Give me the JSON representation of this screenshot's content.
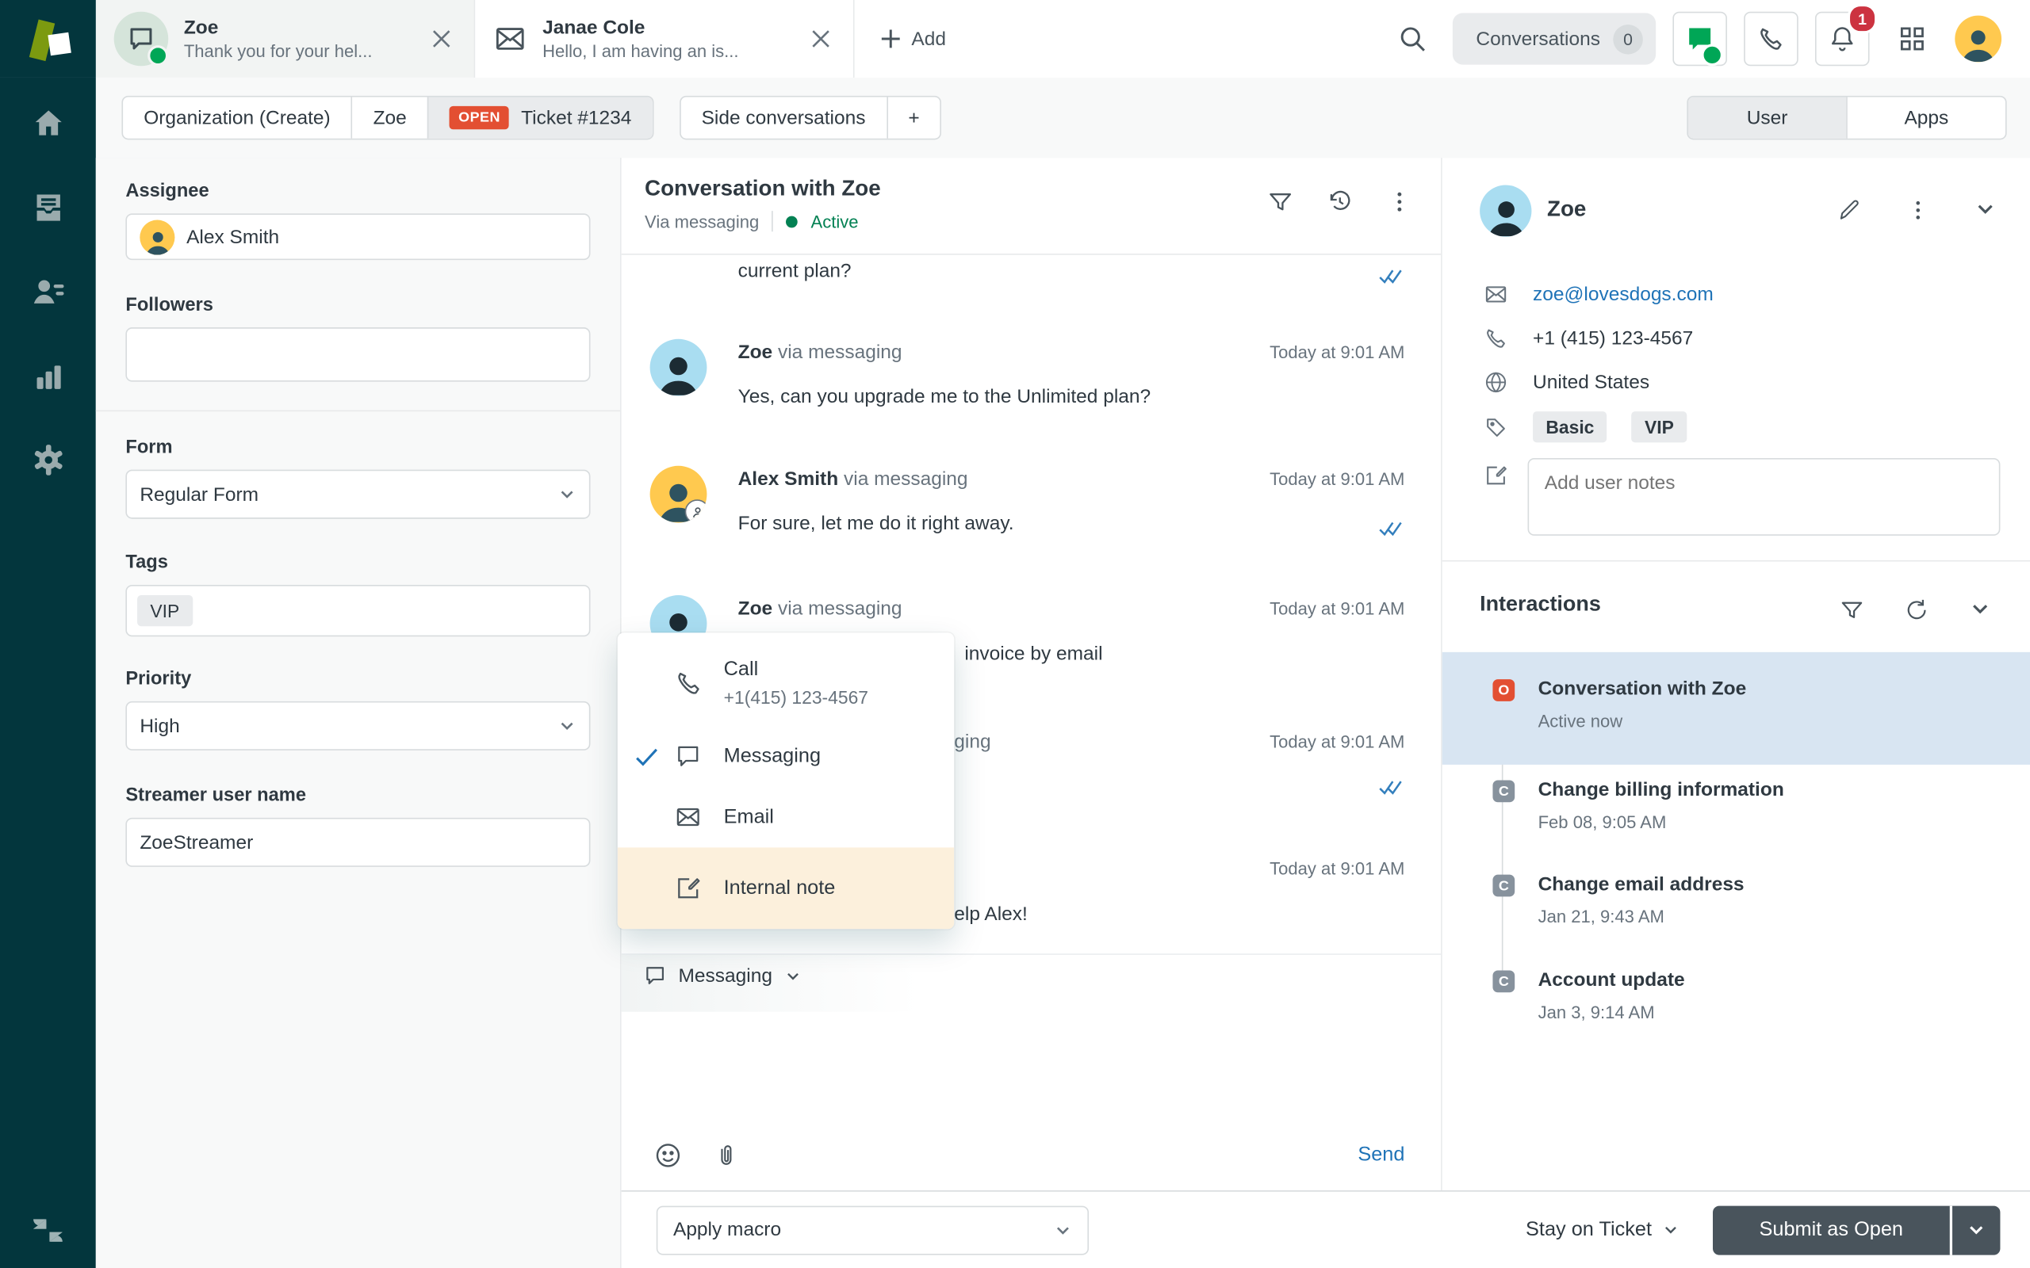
{
  "colors": {
    "brand_teal": "#03363d",
    "accent_green": "#00a656",
    "active_green": "#038153",
    "link_blue": "#1f73b7",
    "check_blue": "#337fbd",
    "status_red": "#e34f32",
    "alert_red": "#cc3340",
    "selected_row_blue": "#d8e5f2",
    "note_highlight": "#fcf0dc",
    "submit_dark": "#49545c"
  },
  "icons": [
    "message-bubble-icon",
    "email-envelope-icon",
    "plus-icon",
    "search-icon",
    "phone-icon",
    "bell-icon",
    "grid-icon",
    "home-icon",
    "views-icon",
    "customers-icon",
    "reporting-icon",
    "admin-gear-icon",
    "funnel-icon",
    "history-icon",
    "kebab-icon",
    "pencil-icon",
    "chevron-down-icon",
    "globe-icon",
    "tag-icon",
    "note-icon",
    "smiley-icon",
    "paperclip-icon",
    "check-icon",
    "double-check-icon",
    "refresh-icon",
    "zendesk-logo"
  ],
  "topbar": {
    "tabs": [
      {
        "title": "Zoe",
        "subtitle": "Thank you for your hel..."
      },
      {
        "title": "Janae Cole",
        "subtitle": "Hello, I am having an is..."
      }
    ],
    "add_label": "Add",
    "conversations": {
      "label": "Conversations",
      "count": "0"
    },
    "notifications_count": "1"
  },
  "breadcrumb": {
    "org": "Organization (Create)",
    "person": "Zoe",
    "status": "OPEN",
    "ticket": "Ticket #1234",
    "side_conversations": "Side conversations",
    "add": "+"
  },
  "panel_tabs": {
    "user": "User",
    "apps": "Apps"
  },
  "fields": {
    "assignee": {
      "label": "Assignee",
      "value": "Alex Smith"
    },
    "followers": {
      "label": "Followers",
      "value": ""
    },
    "form": {
      "label": "Form",
      "value": "Regular Form"
    },
    "tags": {
      "label": "Tags",
      "values": [
        "VIP"
      ]
    },
    "priority": {
      "label": "Priority",
      "value": "High"
    },
    "streamer": {
      "label": "Streamer user name",
      "value": "ZoeStreamer"
    }
  },
  "conversation": {
    "title": "Conversation with Zoe",
    "via": "Via messaging",
    "status": "Active",
    "messages": [
      {
        "fragment_text": "current plan?"
      },
      {
        "author": "Zoe",
        "via": "via messaging",
        "time": "Today at 9:01 AM",
        "text": "Yes, can you upgrade me to the Unlimited plan?"
      },
      {
        "author": "Alex Smith",
        "via": "via messaging",
        "time": "Today at 9:01 AM",
        "text": "For sure, let me do it right away."
      },
      {
        "author": "Zoe",
        "via": "via messaging",
        "time": "Today at 9:01 AM",
        "fragment_text": "invoice by email"
      },
      {
        "via_fragment": "ging",
        "time": "Today at 9:01 AM"
      },
      {
        "time": "Today at 9:01 AM",
        "fragment_text": "elp Alex!"
      }
    ]
  },
  "channel_menu": {
    "items": [
      {
        "label": "Call",
        "sublabel": "+1(415) 123-4567"
      },
      {
        "label": "Messaging",
        "selected": true
      },
      {
        "label": "Email"
      },
      {
        "label": "Internal note",
        "highlighted": true
      }
    ]
  },
  "composer": {
    "channel": "Messaging",
    "send_label": "Send"
  },
  "footer": {
    "apply_macro": "Apply macro",
    "stay_on_ticket": "Stay on Ticket",
    "submit": "Submit as Open"
  },
  "customer": {
    "name": "Zoe",
    "email": "zoe@lovesdogs.com",
    "phone": "+1 (415) 123-4567",
    "country": "United States",
    "tags": [
      "Basic",
      "VIP"
    ],
    "notes_placeholder": "Add user notes"
  },
  "interactions": {
    "title": "Interactions",
    "items": [
      {
        "badge": "O",
        "title": "Conversation with Zoe",
        "time": "Active now",
        "active": true
      },
      {
        "badge": "C",
        "title": "Change billing information",
        "time": "Feb 08, 9:05 AM"
      },
      {
        "badge": "C",
        "title": "Change email address",
        "time": "Jan 21, 9:43 AM"
      },
      {
        "badge": "C",
        "title": "Account update",
        "time": "Jan 3, 9:14 AM"
      }
    ]
  }
}
